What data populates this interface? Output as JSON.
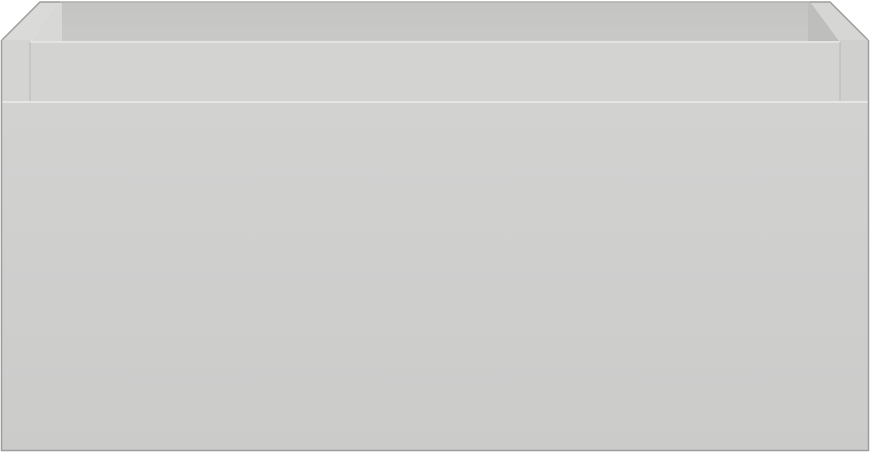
{
  "object": {
    "kind": "drawer-unit",
    "colors": {
      "background": "#ffffff",
      "body": "#cdcdcc",
      "body_shadow": "#c6c6c5",
      "front_panel": "#cfcfce",
      "interior": "#c7c7c6",
      "interior_dark": "#bcbcbb",
      "rim_light": "#e0e0df",
      "edge_line": "#b0b0af",
      "outline": "#9d9d9c"
    }
  }
}
